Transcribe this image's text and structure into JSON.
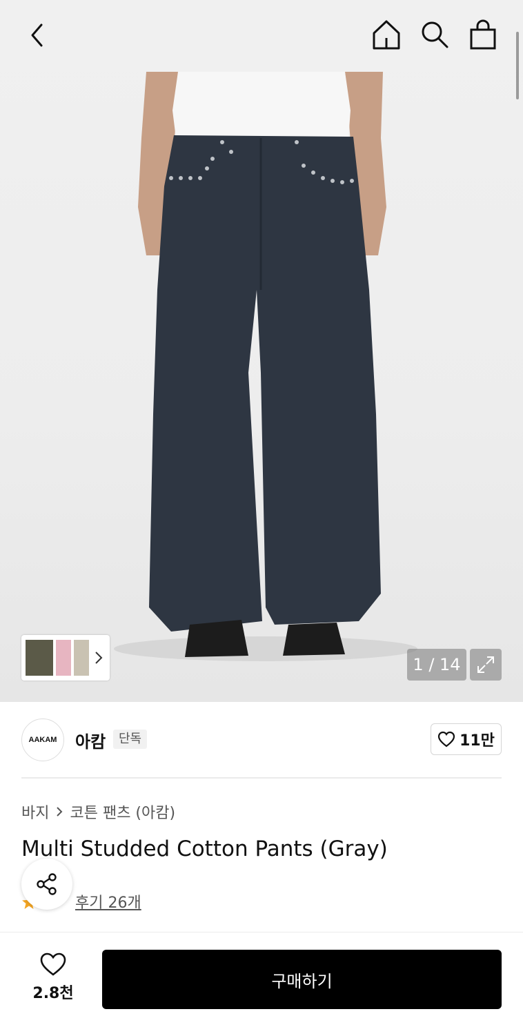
{
  "header": {
    "back_icon": "chevron-left-icon",
    "home_icon": "home-icon",
    "search_icon": "search-icon",
    "cart_icon": "shopping-bag-icon"
  },
  "gallery": {
    "counter": "1 / 14",
    "expand_icon": "expand-icon",
    "variant_colors": [
      "#5b5a48",
      "#e7b5c1",
      "#c9c2b2"
    ]
  },
  "brand": {
    "logo_text": "AAKAM",
    "name": "아캄",
    "exclusive_label": "단독",
    "likes": "11만"
  },
  "product": {
    "breadcrumb": [
      "바지",
      "코튼 팬츠 (아캄)"
    ],
    "title": "Multi Studded Cotton Pants (Gray)",
    "reviews": "후기 26개"
  },
  "bottom_bar": {
    "wish_count": "2.8천",
    "buy_label": "구매하기"
  },
  "colors": {
    "pants": "#2e3642",
    "buy_button": "#000000",
    "star": "#f5a623"
  }
}
